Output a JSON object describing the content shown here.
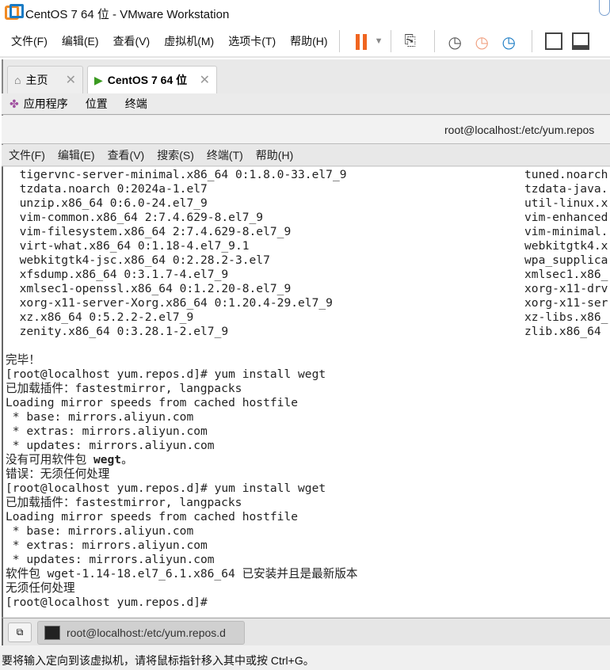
{
  "window": {
    "title": "CentOS 7 64 位 - VMware Workstation"
  },
  "menu": [
    "文件(F)",
    "编辑(E)",
    "查看(V)",
    "虚拟机(M)",
    "选项卡(T)",
    "帮助(H)"
  ],
  "tabs": [
    {
      "label": "主页",
      "icon": "home-icon"
    },
    {
      "label": "CentOS 7 64 位",
      "icon": "vm-running-icon",
      "active": true
    }
  ],
  "gnome": {
    "apps": "应用程序",
    "places": "位置",
    "terminal": "终端"
  },
  "terminal": {
    "title": "root@localhost:/etc/yum.repos",
    "menu": [
      "文件(F)",
      "编辑(E)",
      "查看(V)",
      "搜索(S)",
      "终端(T)",
      "帮助(H)"
    ],
    "left_lines": [
      "  tigervnc-server-minimal.x86_64 0:1.8.0-33.el7_9",
      "  tzdata.noarch 0:2024a-1.el7",
      "  unzip.x86_64 0:6.0-24.el7_9",
      "  vim-common.x86_64 2:7.4.629-8.el7_9",
      "  vim-filesystem.x86_64 2:7.4.629-8.el7_9",
      "  virt-what.x86_64 0:1.18-4.el7_9.1",
      "  webkitgtk4-jsc.x86_64 0:2.28.2-3.el7",
      "  xfsdump.x86_64 0:3.1.7-4.el7_9",
      "  xmlsec1-openssl.x86_64 0:1.2.20-8.el7_9",
      "  xorg-x11-server-Xorg.x86_64 0:1.20.4-29.el7_9",
      "  xz.x86_64 0:5.2.2-2.el7_9",
      "  zenity.x86_64 0:3.28.1-2.el7_9"
    ],
    "right_lines": [
      "tuned.noarch",
      "tzdata-java.",
      "util-linux.x",
      "vim-enhanced",
      "vim-minimal.",
      "webkitgtk4.x",
      "wpa_supplica",
      "xmlsec1.x86_",
      "xorg-x11-drv",
      "xorg-x11-ser",
      "xz-libs.x86_",
      "zlib.x86_64"
    ],
    "output": [
      "",
      "完毕！",
      "[root@localhost yum.repos.d]# yum install wegt",
      "已加载插件：fastestmirror, langpacks",
      "Loading mirror speeds from cached hostfile",
      " * base: mirrors.aliyun.com",
      " * extras: mirrors.aliyun.com",
      " * updates: mirrors.aliyun.com",
      "没有可用软件包 ",
      "错误：无须任何处理",
      "[root@localhost yum.repos.d]# yum install wget",
      "已加载插件：fastestmirror, langpacks",
      "Loading mirror speeds from cached hostfile",
      " * base: mirrors.aliyun.com",
      " * extras: mirrors.aliyun.com",
      " * updates: mirrors.aliyun.com",
      "软件包 wget-1.14-18.el7_6.1.x86_64 已安装并且是最新版本",
      "无须任何处理",
      "[root@localhost yum.repos.d]# "
    ],
    "bold_pkg": "wegt",
    "bold_suffix": "。"
  },
  "taskbar": {
    "item": "root@localhost:/etc/yum.repos.d"
  },
  "status": "要将输入定向到该虚拟机，请将鼠标指针移入其中或按 Ctrl+G。",
  "colors": {
    "pause": "#f06520",
    "accent": "#1a7bc4"
  }
}
